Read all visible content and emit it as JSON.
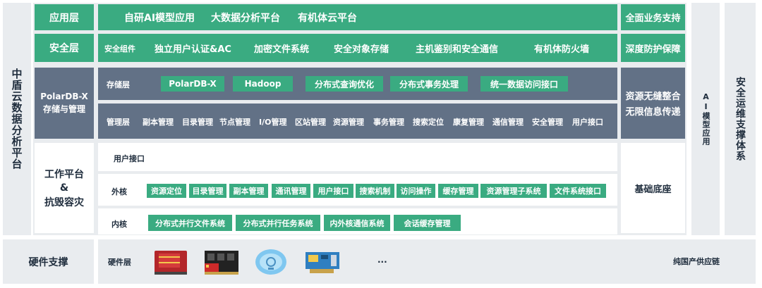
{
  "left_title": "中盾云数据分析平台",
  "application": {
    "label": "应用层",
    "items": [
      "自研AI模型应用",
      "大数据分析平台",
      "有机体云平台"
    ],
    "side": "全面业务支持"
  },
  "security": {
    "label": "安全层",
    "items": [
      "安全组件",
      "独立用户认证&AC",
      "加密文件系统",
      "安全对象存储",
      "主机鉴别和安全通信",
      "有机体防火墙"
    ],
    "side": "深度防护保障"
  },
  "polardb": {
    "label_line1": "PolarDB-X",
    "label_line2": "存储与管理",
    "storage_label": "存储层",
    "storage_items": [
      "PolarDB-X",
      "Hadoop",
      "分布式查询优化",
      "分布式事务处理",
      "统一数据访问接口"
    ],
    "manage_label": "管理层",
    "manage_items": [
      "副本管理",
      "目录管理",
      "节点管理",
      "I/O管理",
      "区站管理",
      "资源管理",
      "事务管理",
      "搜索定位",
      "康复管理",
      "通信管理",
      "安全管理",
      "用户接口"
    ],
    "side_line1": "资源无缝整合",
    "side_line2": "无限信息传递"
  },
  "work": {
    "label_line1": "工作平台",
    "label_line2": "&",
    "label_line3": "抗毁容灾",
    "user_label": "用户接口",
    "outer_label": "外核",
    "outer_items": [
      "资源定位",
      "目录管理",
      "副本管理",
      "通讯管理",
      "用户接口",
      "搜索机制",
      "访问操作",
      "缓存管理",
      "资源管理子系统",
      "文件系统接口"
    ],
    "inner_label": "内核",
    "inner_items": [
      "分布式并行文件系统",
      "分布式并行任务系统",
      "内外核通信系统",
      "会话缓存管理"
    ],
    "side": "基础底座"
  },
  "ai_column": "AI模型应用",
  "ops_column": "安全运维支撑体系",
  "hardware": {
    "label": "硬件支撑",
    "layer_label": "硬件层",
    "ellipsis": "...",
    "supply": "纯国产供应链",
    "icons": [
      "cpu-chip-icon",
      "memory-module-icon",
      "cloud-storage-icon",
      "network-card-icon"
    ]
  }
}
